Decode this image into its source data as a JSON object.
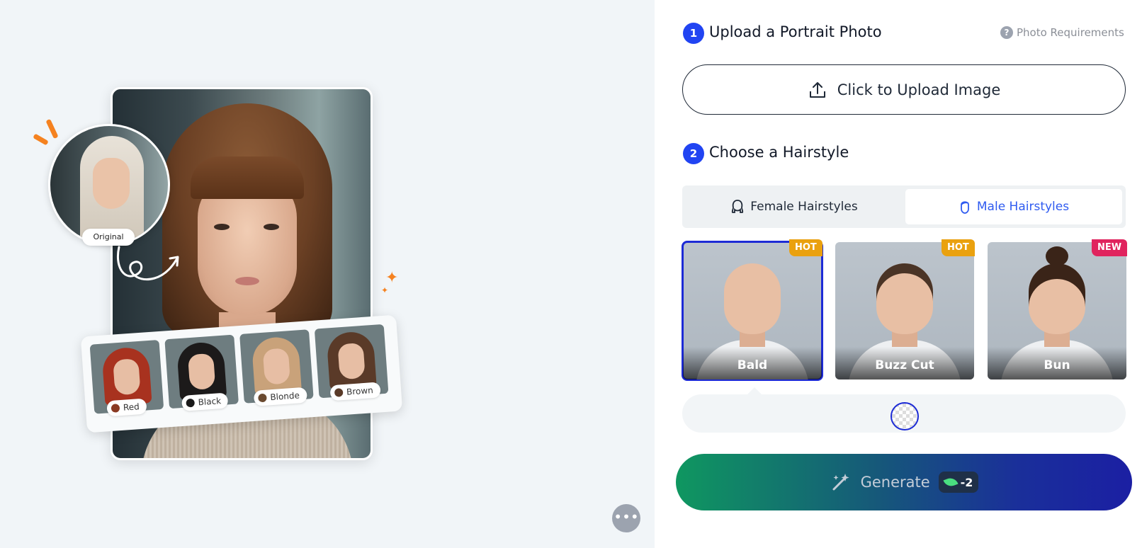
{
  "preview": {
    "original_label": "Original",
    "colors": [
      {
        "label": "Red",
        "hair": "#a8321f",
        "dot": "#8a3a22"
      },
      {
        "label": "Black",
        "hair": "#1c1a1a",
        "dot": "#1a1a1a"
      },
      {
        "label": "Blonde",
        "hair": "#c9a27a",
        "dot": "#6a4a30"
      },
      {
        "label": "Brown",
        "hair": "#5a3a28",
        "dot": "#5a3a28"
      }
    ],
    "accent_color": "#f58220"
  },
  "panel": {
    "step1": {
      "number": "1",
      "title": "Upload a Portrait Photo"
    },
    "photo_requirements": "Photo Requirements",
    "upload_label": "Click to Upload Image",
    "step2": {
      "number": "2",
      "title": "Choose a Hairstyle"
    },
    "tabs": [
      {
        "label": "Female Hairstyles",
        "active": false
      },
      {
        "label": "Male Hairstyles",
        "active": true
      }
    ],
    "styles": [
      {
        "name": "Bald",
        "badge": "HOT",
        "badge_color": "#eaa10f",
        "selected": true
      },
      {
        "name": "Buzz Cut",
        "badge": "HOT",
        "badge_color": "#eaa10f",
        "selected": false
      },
      {
        "name": "Bun",
        "badge": "NEW",
        "badge_color": "#e0245e",
        "selected": false
      }
    ],
    "generate_label": "Generate",
    "generate_cost": "-2",
    "accent_color": "#2144f2"
  }
}
